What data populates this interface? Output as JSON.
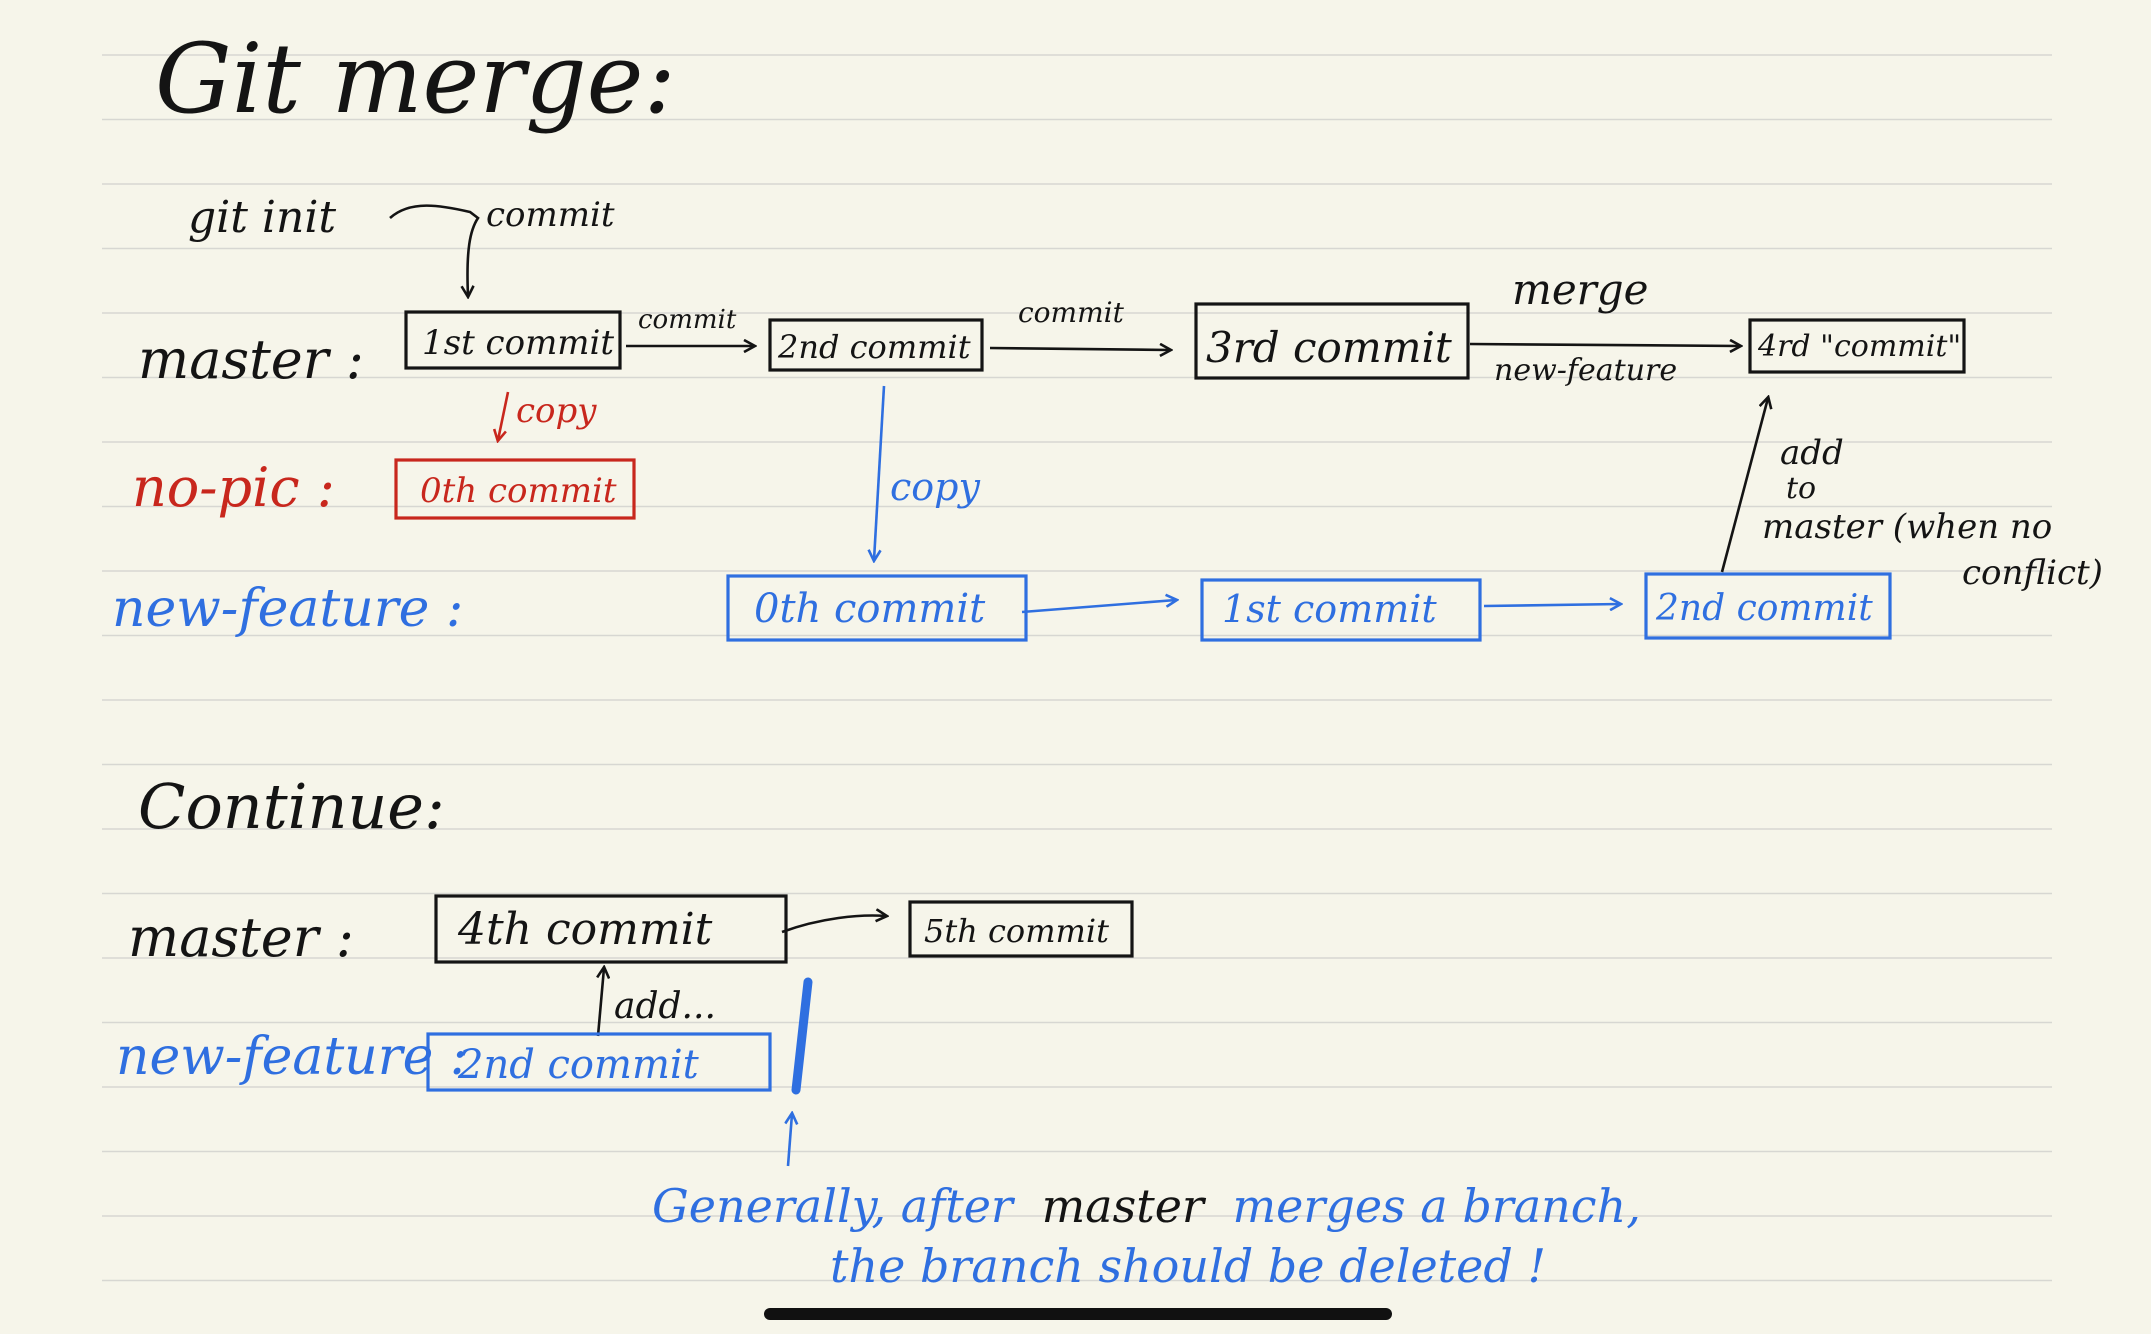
{
  "title": "Git merge:",
  "section1": {
    "git_init": "git init",
    "commit_top": "commit",
    "master_label": "master :",
    "nopic_label": "no-pic :",
    "newfeature_label": "new-feature :",
    "master_commits": [
      "1st commit",
      "2nd commit",
      "3rd commit",
      "4rd \"commit\""
    ],
    "arrow_commit_1": "commit",
    "arrow_commit_2": "commit",
    "merge_label": "merge",
    "merge_sub": "new-feature",
    "copy_red": "copy",
    "copy_blue": "copy",
    "nopic_commit": "0th commit",
    "newfeature_commits": [
      "0th commit",
      "1st commit",
      "2nd commit"
    ],
    "add_note": [
      "add",
      "to",
      "master (when no",
      "conflict)"
    ]
  },
  "section2": {
    "continue_label": "Continue:",
    "master_label": "master :",
    "master_commits": [
      "4th commit",
      "5th commit"
    ],
    "add_label": "add...",
    "newfeature_label": "new-feature :",
    "newfeature_commit": "2nd commit",
    "note_line1": [
      "Generally, after",
      "master",
      "merges a branch,"
    ],
    "note_line2": "the branch should be deleted !"
  },
  "colors": {
    "paper": "#f6f5ea",
    "ink": "#141414",
    "red": "#c8271d",
    "blue": "#2f6fe0"
  }
}
